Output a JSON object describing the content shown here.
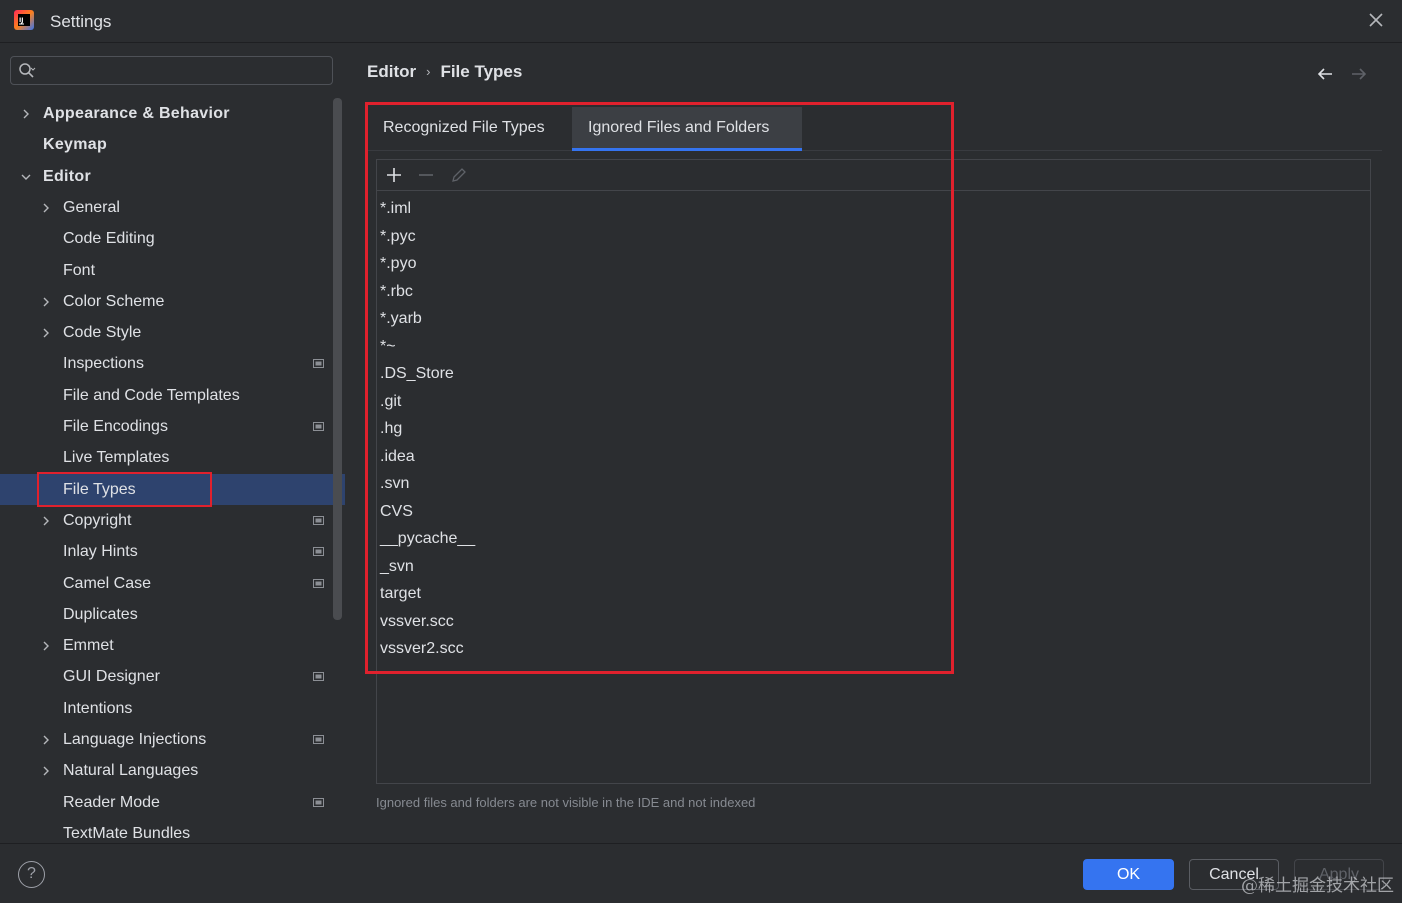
{
  "window": {
    "title": "Settings",
    "icon": "intellij-logo-icon"
  },
  "search": {
    "placeholder": "",
    "value": ""
  },
  "sidebar": {
    "items": [
      {
        "label": "Appearance & Behavior",
        "level": 0,
        "expandable": true,
        "expanded": false,
        "project_icon": false
      },
      {
        "label": "Keymap",
        "level": 0,
        "expandable": false,
        "project_icon": false
      },
      {
        "label": "Editor",
        "level": 0,
        "expandable": true,
        "expanded": true,
        "project_icon": false
      },
      {
        "label": "General",
        "level": 1,
        "expandable": true,
        "expanded": false,
        "project_icon": false
      },
      {
        "label": "Code Editing",
        "level": 1,
        "expandable": false,
        "project_icon": false
      },
      {
        "label": "Font",
        "level": 1,
        "expandable": false,
        "project_icon": false
      },
      {
        "label": "Color Scheme",
        "level": 1,
        "expandable": true,
        "expanded": false,
        "project_icon": false
      },
      {
        "label": "Code Style",
        "level": 1,
        "expandable": true,
        "expanded": false,
        "project_icon": false
      },
      {
        "label": "Inspections",
        "level": 1,
        "expandable": false,
        "project_icon": true
      },
      {
        "label": "File and Code Templates",
        "level": 1,
        "expandable": false,
        "project_icon": false
      },
      {
        "label": "File Encodings",
        "level": 1,
        "expandable": false,
        "project_icon": true
      },
      {
        "label": "Live Templates",
        "level": 1,
        "expandable": false,
        "project_icon": false
      },
      {
        "label": "File Types",
        "level": 1,
        "expandable": false,
        "project_icon": false,
        "selected": true
      },
      {
        "label": "Copyright",
        "level": 1,
        "expandable": true,
        "expanded": false,
        "project_icon": true
      },
      {
        "label": "Inlay Hints",
        "level": 1,
        "expandable": false,
        "project_icon": true
      },
      {
        "label": "Camel Case",
        "level": 1,
        "expandable": false,
        "project_icon": true
      },
      {
        "label": "Duplicates",
        "level": 1,
        "expandable": false,
        "project_icon": false
      },
      {
        "label": "Emmet",
        "level": 1,
        "expandable": true,
        "expanded": false,
        "project_icon": false
      },
      {
        "label": "GUI Designer",
        "level": 1,
        "expandable": false,
        "project_icon": true
      },
      {
        "label": "Intentions",
        "level": 1,
        "expandable": false,
        "project_icon": false
      },
      {
        "label": "Language Injections",
        "level": 1,
        "expandable": true,
        "expanded": false,
        "project_icon": true
      },
      {
        "label": "Natural Languages",
        "level": 1,
        "expandable": true,
        "expanded": false,
        "project_icon": false
      },
      {
        "label": "Reader Mode",
        "level": 1,
        "expandable": false,
        "project_icon": true
      },
      {
        "label": "TextMate Bundles",
        "level": 1,
        "expandable": false,
        "project_icon": false
      }
    ]
  },
  "breadcrumb": {
    "parent": "Editor",
    "separator": "›",
    "current": "File Types"
  },
  "tabs": [
    {
      "label": "Recognized File Types",
      "active": false
    },
    {
      "label": "Ignored Files and Folders",
      "active": true
    }
  ],
  "toolbar": {
    "add_icon": "plus-icon",
    "remove_icon": "minus-icon",
    "edit_icon": "pencil-icon"
  },
  "ignored_items": [
    "*.iml",
    "*.pyc",
    "*.pyo",
    "*.rbc",
    "*.yarb",
    "*~",
    ".DS_Store",
    ".git",
    ".hg",
    ".idea",
    ".svn",
    "CVS",
    "__pycache__",
    "_svn",
    "target",
    "vssver.scc",
    "vssver2.scc"
  ],
  "note": "Ignored files and folders are not visible in the IDE and not indexed",
  "footer": {
    "help": "?",
    "ok": "OK",
    "cancel": "Cancel",
    "apply": "Apply"
  },
  "watermark": "@稀土掘金技术社区",
  "colors": {
    "background": "#2b2d30",
    "selection": "#2e436e",
    "accent": "#3574f0",
    "highlight_box": "#e0212d"
  }
}
